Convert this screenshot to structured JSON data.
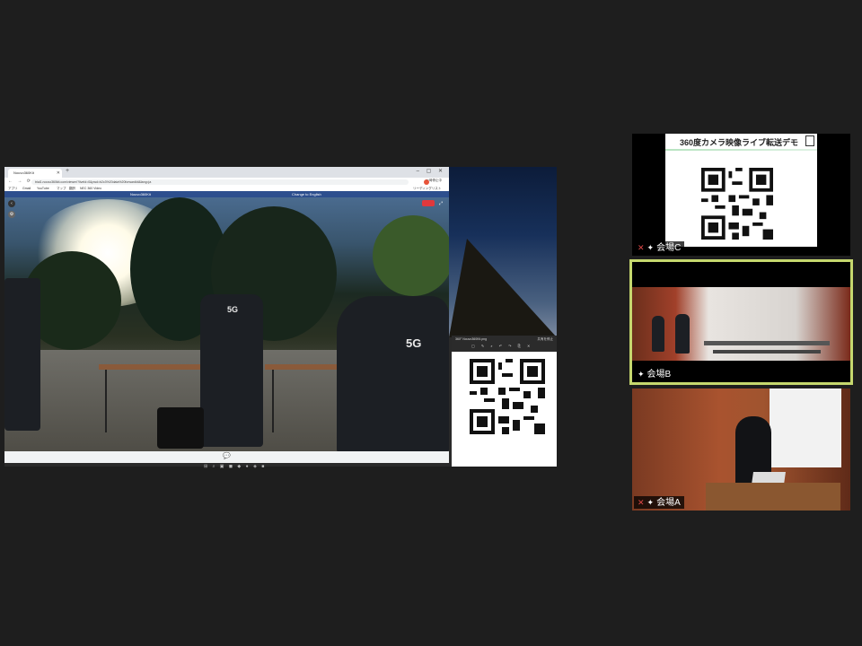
{
  "shared_screen": {
    "browser": {
      "tab_title": "Nouvo360Kit",
      "url": "trial1.nouvo360kit.com/viewer/?liveId=0&pwd=b2c3%20data%20forwardkit&lang=ja",
      "profile_label": "一時停止中",
      "bookmarks": [
        "アプリ",
        "Gmail",
        "YouTube",
        "マップ",
        "翻訳",
        "NEC 360 Video"
      ],
      "reading_list": "リーディングリスト"
    },
    "site": {
      "title": "Nouvo360Kit",
      "language_link": "Change to English"
    },
    "video": {
      "live_badge": "LIVE",
      "jacket_text": "5G"
    },
    "slide_window": {
      "title": "360° Nouvo360Kit.png",
      "button": "共有を停止"
    }
  },
  "tiles": [
    {
      "name": "会場C",
      "slide_title": "360度カメラ映像ライブ転送デモ",
      "muted": true
    },
    {
      "name": "会場B",
      "muted": false,
      "active_speaker": true
    },
    {
      "name": "会場A",
      "muted": true
    }
  ],
  "colors": {
    "background": "#1e1e1e",
    "active_border": "#c6d86e",
    "site_header": "#2d4f8e",
    "muted_icon": "#e04848"
  }
}
